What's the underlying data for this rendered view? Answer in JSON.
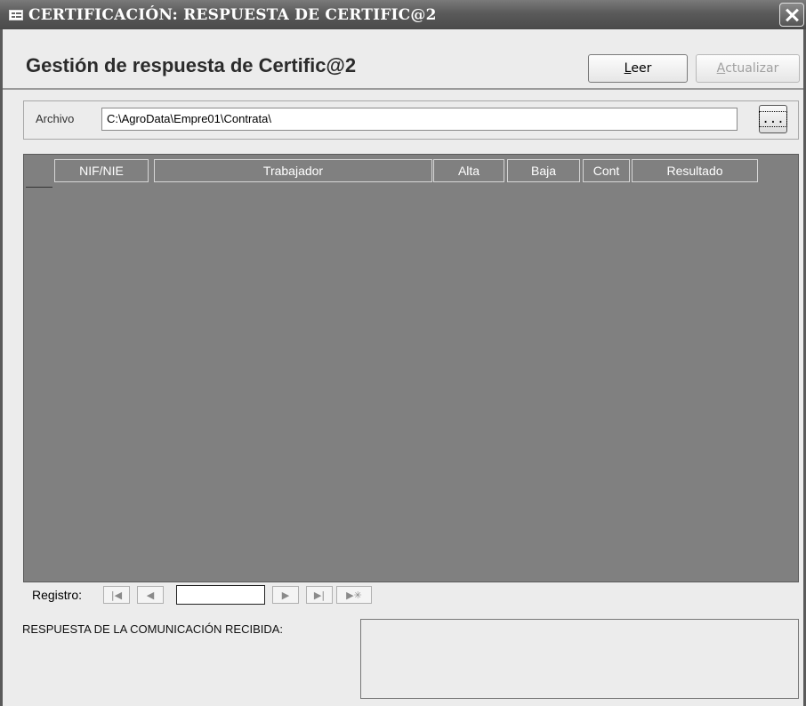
{
  "window": {
    "title": "CERTIFICACIÓN: RESPUESTA DE CERTIFIC@2"
  },
  "header": {
    "title": "Gestión de respuesta de Certific@2",
    "read_button": {
      "accel": "L",
      "rest": "eer"
    },
    "update_button": {
      "accel": "A",
      "rest": "ctualizar"
    }
  },
  "archivo": {
    "label": "Archivo",
    "path": "C:\\AgroData\\Empre01\\Contrata\\",
    "browse_label": "..."
  },
  "grid": {
    "columns": [
      "NIF/NIE",
      "Trabajador",
      "Alta",
      "Baja",
      "Cont",
      "Resultado"
    ]
  },
  "navigation": {
    "label": "Registro:",
    "first_glyph": "|◀",
    "prev_glyph": "◀",
    "next_glyph": "▶",
    "last_glyph": "▶|",
    "new_glyph": "▶✳",
    "record_value": ""
  },
  "response": {
    "label": "RESPUESTA DE LA COMUNICACIÓN RECIBIDA:",
    "value": ""
  }
}
